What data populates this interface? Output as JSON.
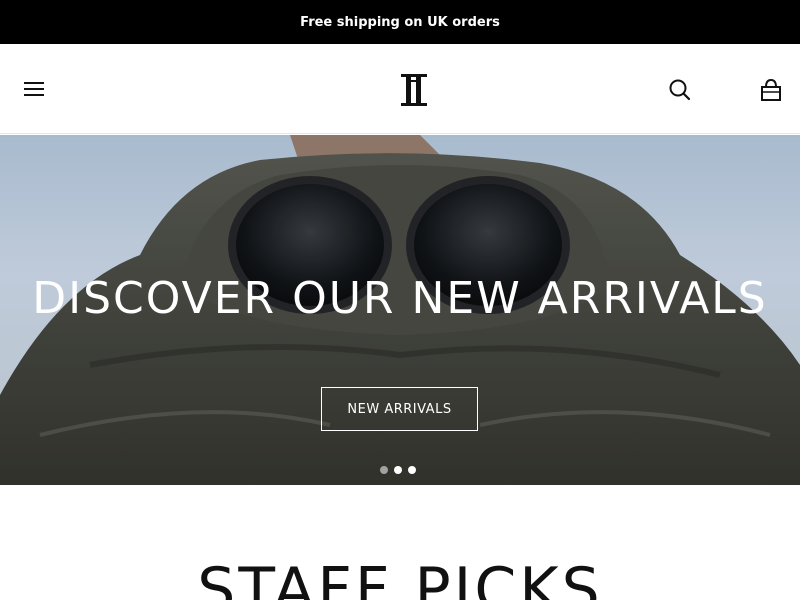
{
  "announcement": {
    "text": "Free shipping on UK orders"
  },
  "header": {
    "menu_icon": "hamburger-menu-icon",
    "logo_icon": "brand-logo",
    "search_icon": "search-icon",
    "cart_icon": "shopping-bag-icon"
  },
  "hero": {
    "title": "DISCOVER OUR NEW ARRIVALS",
    "cta_label": "NEW ARRIVALS",
    "slides_count": 3,
    "active_slide": 2
  },
  "staff_picks": {
    "title": "STAFF PICKS"
  },
  "colors": {
    "announcement_bg": "#000000",
    "text": "#111111",
    "hero_text": "#ffffff"
  }
}
